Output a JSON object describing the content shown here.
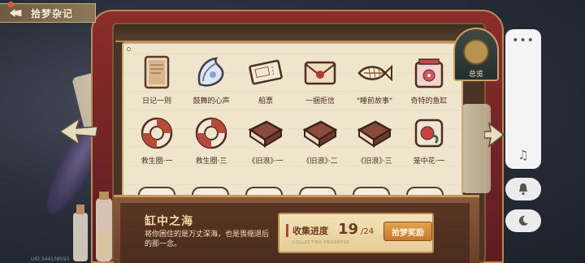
{
  "header": {
    "title": "拾梦杂记"
  },
  "collection": {
    "items": [
      {
        "label": "日记一则",
        "icon": "diary-book-icon"
      },
      {
        "label": "鼓舞的心声",
        "icon": "shell-icon"
      },
      {
        "label": "船票",
        "icon": "ship-ticket-icon"
      },
      {
        "label": "一捆拒信",
        "icon": "sealed-letter-icon"
      },
      {
        "label": "\"睡前故事\"",
        "icon": "fish-bone-icon"
      },
      {
        "label": "奇特的鱼缸",
        "icon": "fish-tank-icon"
      },
      {
        "label": "救生圈·一",
        "icon": "lifebuoy-icon"
      },
      {
        "label": "救生圈·三",
        "icon": "lifebuoy-icon"
      },
      {
        "label": "《旧浪》·一",
        "icon": "old-book-icon"
      },
      {
        "label": "《旧浪》·二",
        "icon": "old-book-icon"
      },
      {
        "label": "《旧浪》·三",
        "icon": "old-book-icon"
      },
      {
        "label": "笼中花·一",
        "icon": "caged-flower-icon"
      }
    ]
  },
  "overview": {
    "label": "总览"
  },
  "region": {
    "title": "缸中之海",
    "description": "将你困住的是万丈深海，也是畏缩退后的那一念。"
  },
  "progress": {
    "label": "收集进度",
    "current": "19",
    "total": "/24",
    "subtext": "COLLECTING PROGRESS",
    "reward_button": "拾梦奖励"
  },
  "uid": "UID:344138593",
  "colors": {
    "curtain_red": "#8b2d2b",
    "paper": "#efe4cc",
    "gold": "#c9a263",
    "reward_orange": "#d98a3a"
  }
}
